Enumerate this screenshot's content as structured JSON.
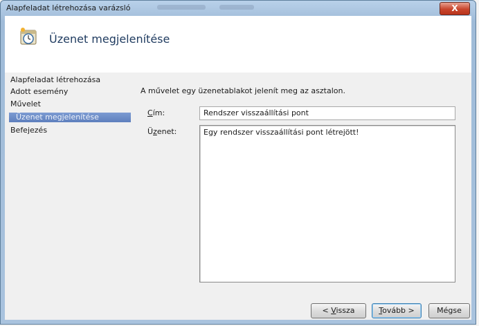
{
  "window": {
    "title": "Alapfeladat létrehozása varázsló",
    "close_label": "X"
  },
  "header": {
    "title": "Üzenet megjelenítése",
    "icon": "calendar-clock-icon"
  },
  "nav": {
    "items": [
      {
        "label": "Alapfeladat létrehozása",
        "selected": false
      },
      {
        "label": "Adott esemény",
        "selected": false
      },
      {
        "label": "Művelet",
        "selected": false
      },
      {
        "label": "Üzenet megjelenítése",
        "selected": true
      },
      {
        "label": "Befejezés",
        "selected": false
      }
    ]
  },
  "main": {
    "description": "A művelet egy üzenetablakot jelenít meg az asztalon.",
    "title_field": {
      "label_prefix": "",
      "label_accel": "C",
      "label_rest": "ím:",
      "value": "Rendszer visszaállítási pont"
    },
    "message_field": {
      "label_prefix": "Ü",
      "label_accel": "z",
      "label_rest": "enet:",
      "value": "Egy rendszer visszaállítási pont létrejött!"
    }
  },
  "buttons": {
    "back": {
      "prefix": "< ",
      "accel": "V",
      "rest": "issza"
    },
    "next": {
      "prefix": "",
      "accel": "T",
      "rest": "ovább >"
    },
    "cancel": {
      "label": "Mégse"
    }
  },
  "colors": {
    "titlebar": "#b9d1ea",
    "selection": "#5e7fbd",
    "close": "#c8452c"
  }
}
